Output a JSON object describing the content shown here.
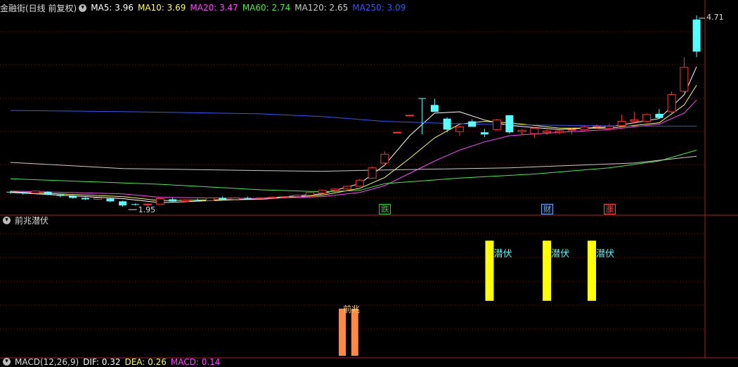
{
  "main_header": {
    "title": "金融街(日线 前复权)",
    "ma": [
      {
        "label": "MA5: 3.96",
        "color": "#ffffff"
      },
      {
        "label": "MA10: 3.69",
        "color": "#ffff44"
      },
      {
        "label": "MA20: 3.47",
        "color": "#ff44ff"
      },
      {
        "label": "MA60: 2.74",
        "color": "#44ee44"
      },
      {
        "label": "MA120: 2.65",
        "color": "#cccccc"
      },
      {
        "label": "MA250: 3.09",
        "color": "#3355ff"
      }
    ]
  },
  "price": {
    "high_label": "4.71",
    "low_label": "1.95"
  },
  "markers": [
    {
      "text": "跌",
      "color": "#22cc22"
    },
    {
      "text": "财",
      "color": "#66aaff"
    },
    {
      "text": "涨",
      "color": "#ff4444"
    }
  ],
  "indicator": {
    "title": "前兆潜伏",
    "signal_front": "前兆",
    "signal_hide": "潜伏"
  },
  "macd_header": {
    "title": "MACD(12,26,9)",
    "dif": "DIF: 0.32",
    "dea": "DEA: 0.26",
    "macd": "MACD: 0.14"
  },
  "chart_data": {
    "type": "candlestick",
    "ylim": [
      1.85,
      4.75
    ],
    "x_count": 56,
    "candles": [
      [
        2.13,
        2.14,
        2.1,
        2.12
      ],
      [
        2.12,
        2.13,
        2.09,
        2.11
      ],
      [
        2.11,
        2.15,
        2.1,
        2.14
      ],
      [
        2.13,
        2.14,
        2.08,
        2.09
      ],
      [
        2.09,
        2.1,
        2.05,
        2.07
      ],
      [
        2.07,
        2.08,
        2.03,
        2.04
      ],
      [
        2.04,
        2.05,
        2.01,
        2.02
      ],
      [
        2.02,
        2.05,
        2.01,
        2.04
      ],
      [
        2.03,
        2.04,
        1.98,
        1.99
      ],
      [
        1.99,
        2.0,
        1.91,
        1.93
      ],
      [
        1.95,
        1.96,
        1.93,
        1.94
      ],
      [
        1.94,
        1.96,
        1.92,
        1.95
      ],
      [
        1.95,
        2.05,
        1.95,
        2.03
      ],
      [
        2.02,
        2.04,
        1.97,
        1.99
      ],
      [
        1.99,
        2.02,
        1.97,
        2.01
      ],
      [
        2.01,
        2.03,
        1.99,
        2.0
      ],
      [
        2.0,
        2.05,
        1.99,
        2.04
      ],
      [
        2.04,
        2.06,
        2.01,
        2.02
      ],
      [
        2.02,
        2.05,
        2.01,
        2.04
      ],
      [
        2.04,
        2.06,
        2.02,
        2.03
      ],
      [
        2.03,
        2.05,
        2.02,
        2.04
      ],
      [
        2.04,
        2.06,
        2.03,
        2.05
      ],
      [
        2.05,
        2.07,
        2.04,
        2.06
      ],
      [
        2.06,
        2.09,
        2.05,
        2.08
      ],
      [
        2.08,
        2.13,
        2.07,
        2.12
      ],
      [
        2.11,
        2.16,
        2.1,
        2.15
      ],
      [
        2.15,
        2.18,
        2.12,
        2.17
      ],
      [
        2.17,
        2.22,
        2.15,
        2.21
      ],
      [
        2.21,
        2.32,
        2.2,
        2.3
      ],
      [
        2.33,
        2.5,
        2.32,
        2.48
      ],
      [
        2.55,
        2.72,
        2.5,
        2.68
      ],
      [
        3.0,
        3.01,
        2.99,
        3.0
      ],
      [
        3.25,
        3.25,
        3.24,
        3.25
      ],
      [
        3.5,
        3.5,
        2.97,
        3.49
      ],
      [
        3.4,
        3.49,
        3.3,
        3.3
      ],
      [
        3.2,
        3.22,
        3.0,
        3.04
      ],
      [
        3.01,
        3.1,
        2.95,
        3.08
      ],
      [
        3.16,
        3.19,
        3.08,
        3.08
      ],
      [
        3.0,
        3.05,
        2.93,
        2.97
      ],
      [
        3.04,
        3.2,
        3.02,
        3.18
      ],
      [
        3.25,
        3.25,
        2.98,
        3.0
      ],
      [
        3.01,
        3.05,
        2.96,
        3.03
      ],
      [
        2.98,
        3.08,
        2.92,
        3.06
      ],
      [
        3.0,
        3.04,
        2.96,
        3.02
      ],
      [
        3.0,
        3.03,
        2.97,
        3.02
      ],
      [
        3.03,
        3.06,
        2.97,
        3.04
      ],
      [
        3.04,
        3.1,
        3.02,
        3.08
      ],
      [
        3.08,
        3.12,
        3.05,
        3.09
      ],
      [
        3.06,
        3.12,
        3.04,
        3.09
      ],
      [
        3.1,
        3.26,
        3.09,
        3.16
      ],
      [
        3.16,
        3.3,
        3.12,
        3.18
      ],
      [
        3.16,
        3.28,
        3.14,
        3.26
      ],
      [
        3.27,
        3.34,
        3.2,
        3.21
      ],
      [
        3.3,
        3.6,
        3.28,
        3.55
      ],
      [
        3.6,
        4.1,
        3.58,
        3.95
      ],
      [
        4.65,
        4.71,
        4.1,
        4.18
      ]
    ],
    "ma_lines": {
      "MA5": [
        [
          0,
          2.12
        ],
        [
          9,
          2.03
        ],
        [
          12,
          1.97
        ],
        [
          20,
          2.03
        ],
        [
          25,
          2.1
        ],
        [
          28,
          2.25
        ],
        [
          30,
          2.52
        ],
        [
          32,
          2.95
        ],
        [
          34,
          3.28
        ],
        [
          36,
          3.3
        ],
        [
          38,
          3.18
        ],
        [
          40,
          3.1
        ],
        [
          44,
          3.04
        ],
        [
          48,
          3.08
        ],
        [
          50,
          3.14
        ],
        [
          52,
          3.2
        ],
        [
          54,
          3.55
        ],
        [
          55,
          3.96
        ]
      ],
      "MA10": [
        [
          0,
          2.13
        ],
        [
          9,
          2.06
        ],
        [
          12,
          2.0
        ],
        [
          20,
          2.02
        ],
        [
          25,
          2.08
        ],
        [
          28,
          2.18
        ],
        [
          30,
          2.34
        ],
        [
          32,
          2.62
        ],
        [
          34,
          2.92
        ],
        [
          36,
          3.12
        ],
        [
          38,
          3.16
        ],
        [
          40,
          3.14
        ],
        [
          44,
          3.06
        ],
        [
          48,
          3.06
        ],
        [
          50,
          3.1
        ],
        [
          52,
          3.14
        ],
        [
          54,
          3.4
        ],
        [
          55,
          3.69
        ]
      ],
      "MA20": [
        [
          0,
          2.14
        ],
        [
          9,
          2.1
        ],
        [
          12,
          2.05
        ],
        [
          20,
          2.03
        ],
        [
          25,
          2.06
        ],
        [
          28,
          2.12
        ],
        [
          30,
          2.22
        ],
        [
          32,
          2.4
        ],
        [
          34,
          2.58
        ],
        [
          36,
          2.74
        ],
        [
          38,
          2.86
        ],
        [
          40,
          2.95
        ],
        [
          44,
          3.0
        ],
        [
          48,
          3.04
        ],
        [
          50,
          3.08
        ],
        [
          52,
          3.12
        ],
        [
          54,
          3.28
        ],
        [
          55,
          3.47
        ]
      ],
      "MA60": [
        [
          0,
          2.32
        ],
        [
          12,
          2.24
        ],
        [
          20,
          2.16
        ],
        [
          25,
          2.13
        ],
        [
          28,
          2.15
        ],
        [
          30,
          2.25
        ],
        [
          36,
          2.33
        ],
        [
          42,
          2.39
        ],
        [
          48,
          2.48
        ],
        [
          52,
          2.58
        ],
        [
          55,
          2.74
        ]
      ],
      "MA120": [
        [
          0,
          2.56
        ],
        [
          9,
          2.47
        ],
        [
          20,
          2.44
        ],
        [
          25,
          2.43
        ],
        [
          30,
          2.45
        ],
        [
          40,
          2.48
        ],
        [
          50,
          2.55
        ],
        [
          55,
          2.65
        ]
      ],
      "MA250": [
        [
          0,
          3.32
        ],
        [
          10,
          3.3
        ],
        [
          20,
          3.27
        ],
        [
          25,
          3.23
        ],
        [
          30,
          3.16
        ],
        [
          35,
          3.13
        ],
        [
          40,
          3.11
        ],
        [
          45,
          3.1
        ],
        [
          50,
          3.09
        ],
        [
          55,
          3.09
        ]
      ]
    },
    "marker_x": [
      30,
      43,
      48
    ],
    "indicator_bars": [
      {
        "type": "front",
        "x": 26.6,
        "top": 0.36,
        "bottom": 0.0
      },
      {
        "type": "front",
        "x": 27.6,
        "top": 0.36,
        "bottom": 0.0
      },
      {
        "type": "hide",
        "x": 38.4,
        "top": 0.88,
        "bottom": 0.42
      },
      {
        "type": "hide",
        "x": 43.0,
        "top": 0.88,
        "bottom": 0.42
      },
      {
        "type": "hide",
        "x": 46.6,
        "top": 0.88,
        "bottom": 0.42
      }
    ]
  }
}
